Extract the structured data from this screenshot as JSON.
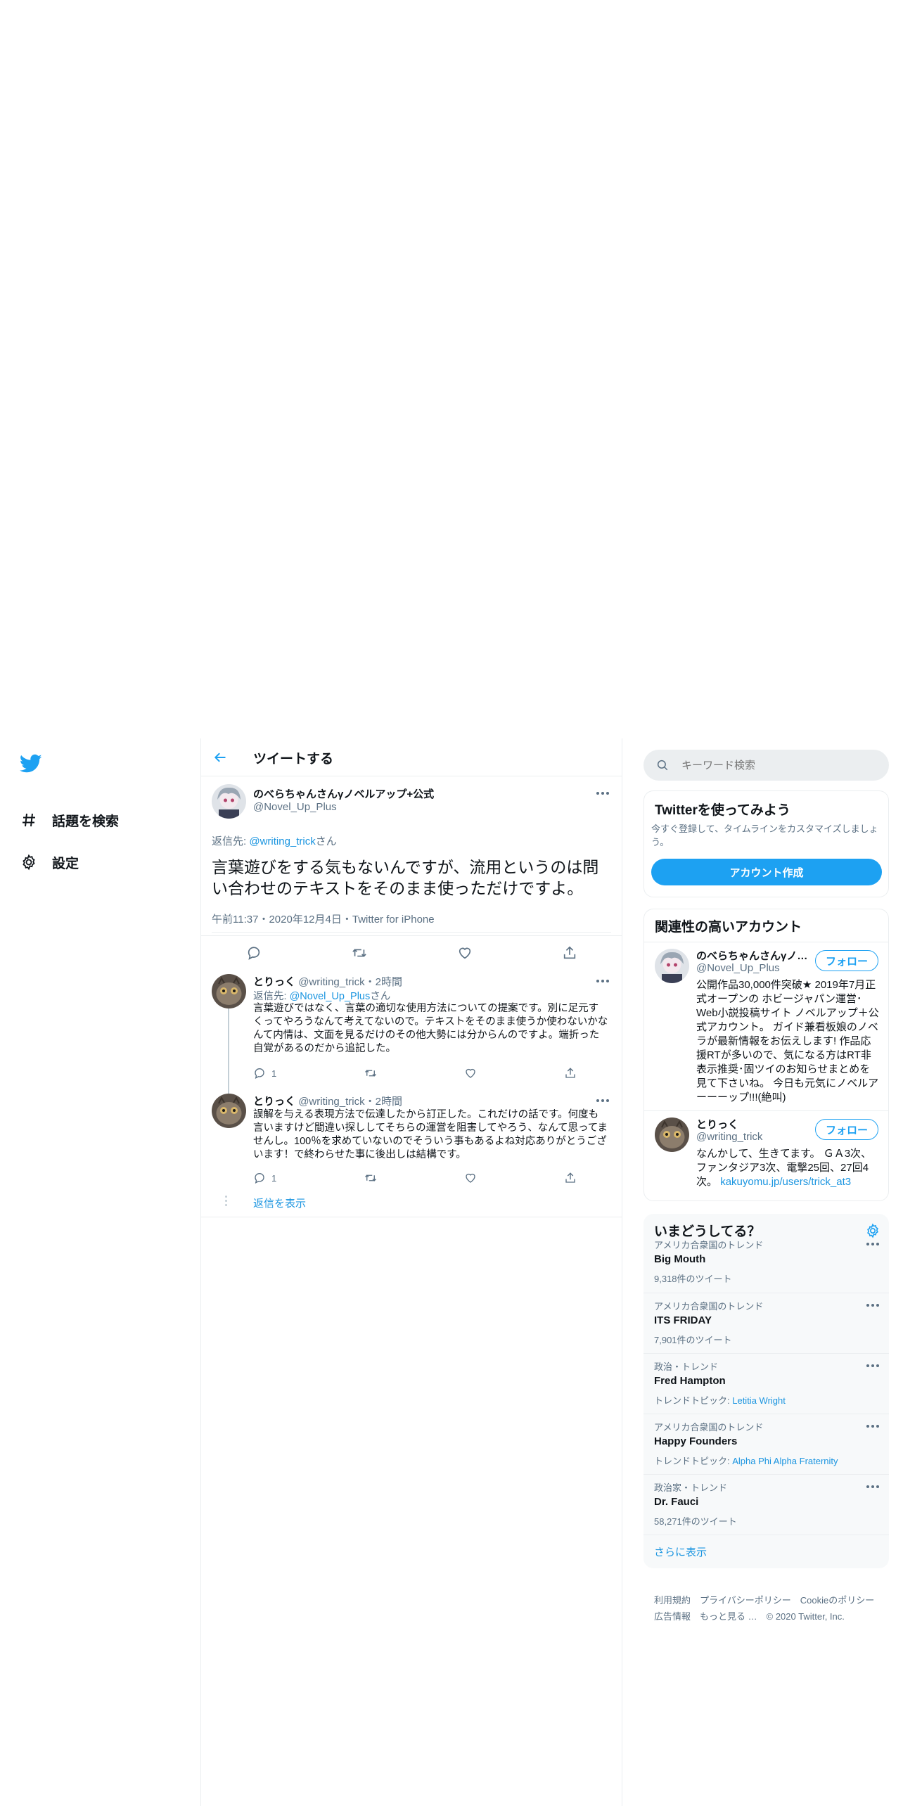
{
  "nav": {
    "logo": "twitter-bird-icon",
    "items": [
      {
        "label": "話題を検索",
        "icon": "hashtag-icon"
      },
      {
        "label": "設定",
        "icon": "gear-icon"
      }
    ]
  },
  "header": {
    "title": "ツイートする"
  },
  "main_tweet": {
    "name": "のべらちゃんさんγノベルアップ+公式",
    "handle": "@Novel_Up_Plus",
    "reply_prefix": "返信先: ",
    "reply_to": "@writing_trick",
    "reply_suffix": "さん",
    "text": "言葉遊びをする気もないんですが、流用というのは問い合わせのテキストをそのまま使っただけですよ。",
    "time": "午前11:37",
    "date": "2020年12月4日",
    "source": "Twitter for iPhone",
    "sep": "・"
  },
  "replies": [
    {
      "name": "とりっく",
      "handle": "@writing_trick",
      "time": "・2時間",
      "reply_prefix": "返信先: ",
      "reply_to": "@Novel_Up_Plus",
      "reply_suffix": "さん",
      "text": "言葉遊びではなく、言葉の適切な使用方法についての提案です。別に足元すくってやろうなんて考えてないので。テキストをそのまま使うか使わないかなんて内情は、文面を見るだけのその他大勢には分からんのですよ。端折った自覚があるのだから追記した。",
      "reply_count": "1"
    },
    {
      "name": "とりっく",
      "handle": "@writing_trick",
      "time": "・2時間",
      "text": "誤解を与える表現方法で伝達したから訂正した。これだけの話です。何度も言いますけど間違い探ししてそちらの運営を阻害してやろう、なんて思ってませんし。100％を求めていないのでそういう事もあるよね対応ありがとうございます！で終わらせた事に後出しは結構です。",
      "reply_count": "1"
    }
  ],
  "show_replies": "返信を表示",
  "search": {
    "placeholder": "キーワード検索"
  },
  "signup": {
    "title": "Twitterを使ってみよう",
    "desc": "今すぐ登録して、タイムラインをカスタマイズしましょう。",
    "button": "アカウント作成"
  },
  "related": {
    "title": "関連性の高いアカウント",
    "accounts": [
      {
        "name": "のべらちゃんさんγノベルアップ+公式",
        "handle": "@Novel_Up_Plus",
        "follow": "フォロー",
        "bio": "公開作品30,000件突破★ 2019年7月正式オープンの ホビージャパン運営･Web小説投稿サイト ノベルアップ＋公式アカウント。 ガイド兼看板娘のノベラが最新情報をお伝えします! 作品応援RTが多いので、気になる方はRT非表示推奨･固ツイのお知らせまとめを見て下さいね。 今日も元気にノベルアーーーップ!!!(絶叫)"
      },
      {
        "name": "とりっく",
        "handle": "@writing_trick",
        "follow": "フォロー",
        "bio": "なんかして、生きてます。 ＧＡ3次、ファンタジア3次、電撃25回、27回4次。",
        "link": "kakuyomu.jp/users/trick_at3"
      }
    ]
  },
  "trends": {
    "title": "いまどうしてる？",
    "items": [
      {
        "context": "アメリカ合衆国のトレンド",
        "name": "Big Mouth",
        "count": "9,318件のツイート"
      },
      {
        "context": "アメリカ合衆国のトレンド",
        "name": "ITS FRIDAY",
        "count": "7,901件のツイート"
      },
      {
        "context": "政治・トレンド",
        "name": "Fred Hampton",
        "topic_prefix": "トレンドトピック: ",
        "topic": "Letitia Wright"
      },
      {
        "context": "アメリカ合衆国のトレンド",
        "name": "Happy Founders",
        "topic_prefix": "トレンドトピック: ",
        "topic": "Alpha Phi Alpha Fraternity"
      },
      {
        "context": "政治家・トレンド",
        "name": "Dr. Fauci",
        "count": "58,271件のツイート"
      }
    ],
    "show_more": "さらに表示"
  },
  "footer": {
    "links": [
      "利用規約",
      "プライバシーポリシー",
      "Cookieのポリシー",
      "広告情報",
      "もっと見る …"
    ],
    "copyright": "© 2020 Twitter, Inc."
  },
  "colors": {
    "accent": "#1da1f2",
    "link": "#1b95e0",
    "muted": "#5b7083",
    "border": "#ebeef0"
  }
}
